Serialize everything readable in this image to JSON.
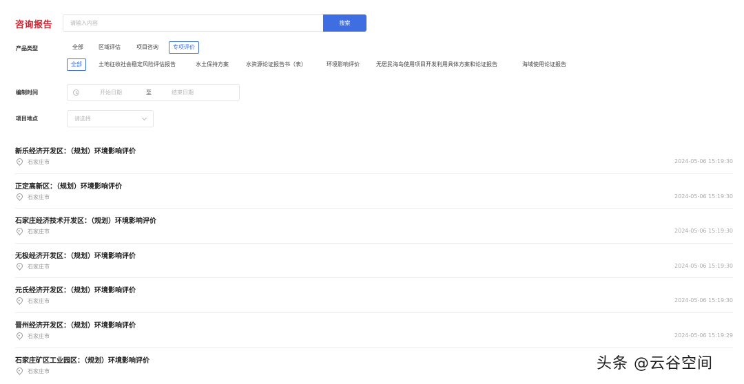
{
  "header": {
    "title": "咨询报告",
    "search_placeholder": "请输入内容",
    "search_button": "搜索"
  },
  "filters": {
    "product_type_label": "产品类型",
    "product_types": [
      "全部",
      "区域评估",
      "项目咨询",
      "专项评价"
    ],
    "sub_types": [
      "全部",
      "土地征收社会稳定风险评估报告",
      "水土保持方案",
      "水资源论证报告书（表）",
      "环境影响评价",
      "无居民海岛使用项目开发利用具体方案和论证报告",
      "海域使用论证报告"
    ],
    "time_label": "编制时间",
    "start_placeholder": "开始日期",
    "date_separator": "至",
    "end_placeholder": "结束日期",
    "location_label": "项目地点",
    "location_placeholder": "请选择"
  },
  "reports": [
    {
      "title": "新乐经济开发区：（规划）环境影响评价",
      "location": "石家庄市",
      "time": "2024-05-06 15:19:30"
    },
    {
      "title": "正定高新区：（规划）环境影响评价",
      "location": "石家庄市",
      "time": "2024-05-06 15:19:30"
    },
    {
      "title": "石家庄经济技术开发区：（规划）环境影响评价",
      "location": "石家庄市",
      "time": "2024-05-06 15:19:30"
    },
    {
      "title": "无极经济开发区：（规划）环境影响评价",
      "location": "石家庄市",
      "time": "2024-05-06 15:19:30"
    },
    {
      "title": "元氏经济开发区：（规划）环境影响评价",
      "location": "石家庄市",
      "time": "2024-05-06 15:19:30"
    },
    {
      "title": "晋州经济开发区：（规划）环境影响评价",
      "location": "石家庄市",
      "time": "2024-05-06 15:19:29"
    },
    {
      "title": "石家庄矿区工业园区：（规划）环境影响评价",
      "location": "石家庄市",
      "time": ""
    }
  ],
  "watermark": "头条 @云谷空间",
  "colors": {
    "accent": "#3f6ee3",
    "title_red": "#d2202d"
  }
}
